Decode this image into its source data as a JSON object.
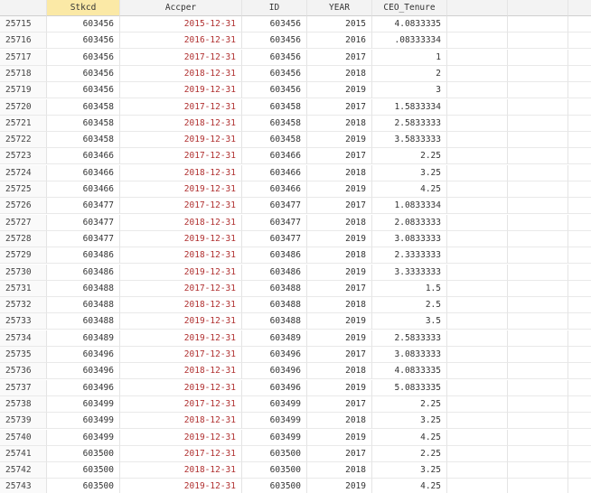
{
  "columns": [
    "Stkcd",
    "Accper",
    "ID",
    "YEAR",
    "CEO_Tenure"
  ],
  "rows": [
    [
      "25715",
      "603456",
      "2015-12-31",
      "603456",
      "2015",
      "4.0833335"
    ],
    [
      "25716",
      "603456",
      "2016-12-31",
      "603456",
      "2016",
      ".08333334"
    ],
    [
      "25717",
      "603456",
      "2017-12-31",
      "603456",
      "2017",
      "1"
    ],
    [
      "25718",
      "603456",
      "2018-12-31",
      "603456",
      "2018",
      "2"
    ],
    [
      "25719",
      "603456",
      "2019-12-31",
      "603456",
      "2019",
      "3"
    ],
    [
      "25720",
      "603458",
      "2017-12-31",
      "603458",
      "2017",
      "1.5833334"
    ],
    [
      "25721",
      "603458",
      "2018-12-31",
      "603458",
      "2018",
      "2.5833333"
    ],
    [
      "25722",
      "603458",
      "2019-12-31",
      "603458",
      "2019",
      "3.5833333"
    ],
    [
      "25723",
      "603466",
      "2017-12-31",
      "603466",
      "2017",
      "2.25"
    ],
    [
      "25724",
      "603466",
      "2018-12-31",
      "603466",
      "2018",
      "3.25"
    ],
    [
      "25725",
      "603466",
      "2019-12-31",
      "603466",
      "2019",
      "4.25"
    ],
    [
      "25726",
      "603477",
      "2017-12-31",
      "603477",
      "2017",
      "1.0833334"
    ],
    [
      "25727",
      "603477",
      "2018-12-31",
      "603477",
      "2018",
      "2.0833333"
    ],
    [
      "25728",
      "603477",
      "2019-12-31",
      "603477",
      "2019",
      "3.0833333"
    ],
    [
      "25729",
      "603486",
      "2018-12-31",
      "603486",
      "2018",
      "2.3333333"
    ],
    [
      "25730",
      "603486",
      "2019-12-31",
      "603486",
      "2019",
      "3.3333333"
    ],
    [
      "25731",
      "603488",
      "2017-12-31",
      "603488",
      "2017",
      "1.5"
    ],
    [
      "25732",
      "603488",
      "2018-12-31",
      "603488",
      "2018",
      "2.5"
    ],
    [
      "25733",
      "603488",
      "2019-12-31",
      "603488",
      "2019",
      "3.5"
    ],
    [
      "25734",
      "603489",
      "2019-12-31",
      "603489",
      "2019",
      "2.5833333"
    ],
    [
      "25735",
      "603496",
      "2017-12-31",
      "603496",
      "2017",
      "3.0833333"
    ],
    [
      "25736",
      "603496",
      "2018-12-31",
      "603496",
      "2018",
      "4.0833335"
    ],
    [
      "25737",
      "603496",
      "2019-12-31",
      "603496",
      "2019",
      "5.0833335"
    ],
    [
      "25738",
      "603499",
      "2017-12-31",
      "603499",
      "2017",
      "2.25"
    ],
    [
      "25739",
      "603499",
      "2018-12-31",
      "603499",
      "2018",
      "3.25"
    ],
    [
      "25740",
      "603499",
      "2019-12-31",
      "603499",
      "2019",
      "4.25"
    ],
    [
      "25741",
      "603500",
      "2017-12-31",
      "603500",
      "2017",
      "2.25"
    ],
    [
      "25742",
      "603500",
      "2018-12-31",
      "603500",
      "2018",
      "3.25"
    ],
    [
      "25743",
      "603500",
      "2019-12-31",
      "603500",
      "2019",
      "4.25"
    ]
  ]
}
